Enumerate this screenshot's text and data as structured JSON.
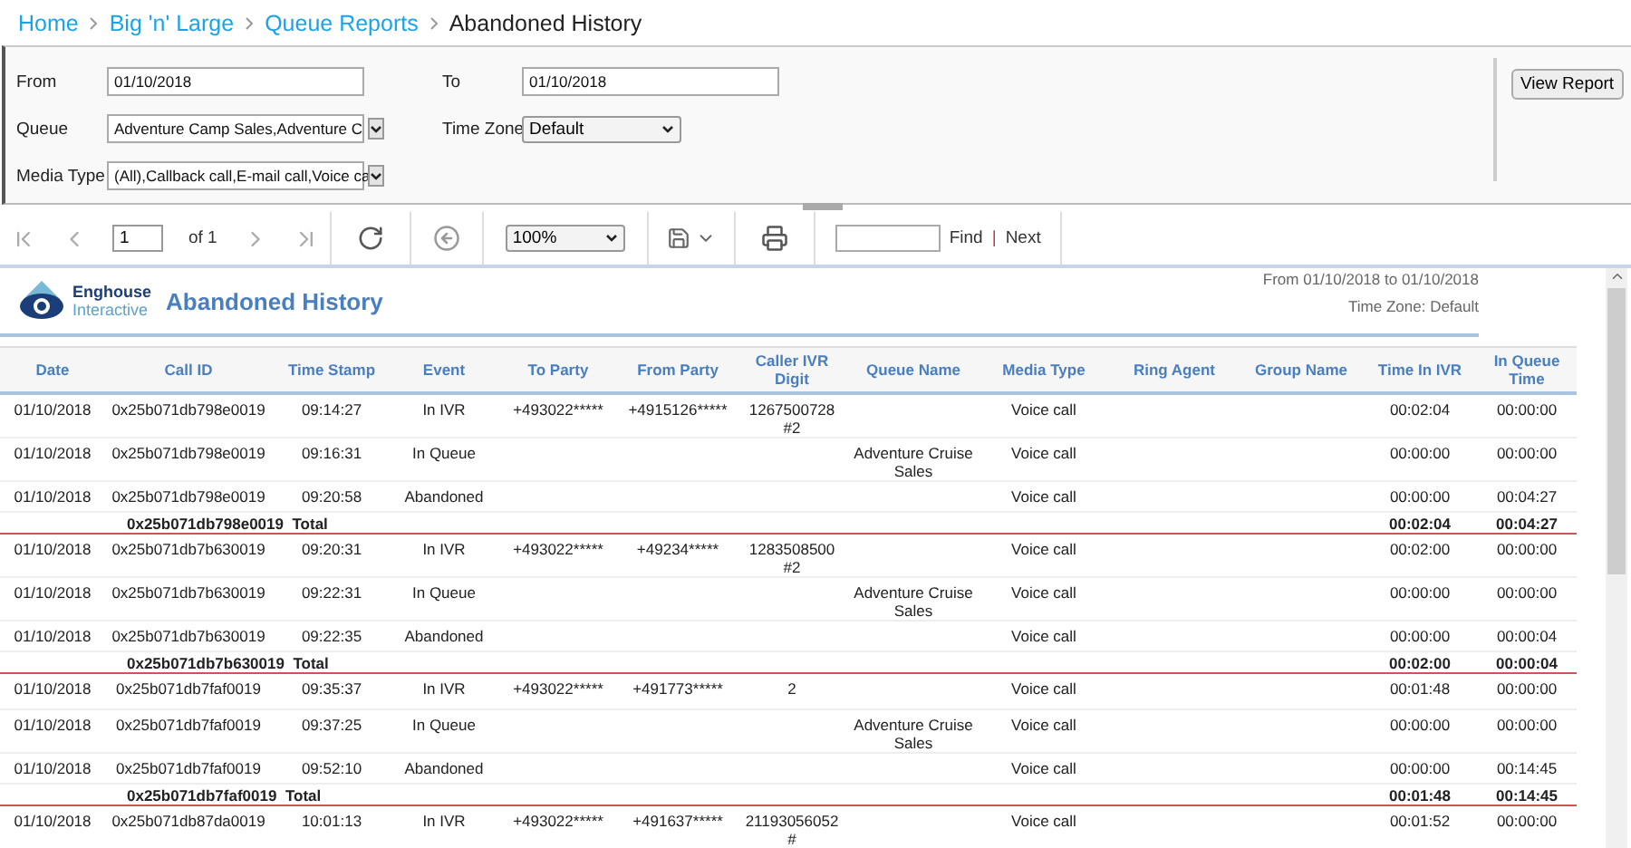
{
  "breadcrumb": [
    {
      "label": "Home",
      "kind": "link"
    },
    {
      "label": "Big 'n' Large",
      "kind": "link"
    },
    {
      "label": "Queue Reports",
      "kind": "link"
    },
    {
      "label": "Abandoned History",
      "kind": "current"
    }
  ],
  "parameters": {
    "from": {
      "label": "From",
      "value": "01/10/2018"
    },
    "to": {
      "label": "To",
      "value": "01/10/2018"
    },
    "queue": {
      "label": "Queue",
      "value": "Adventure Camp Sales,Adventure C"
    },
    "time_zone": {
      "label": "Time Zone",
      "value": "Default"
    },
    "media_type": {
      "label": "Media Type",
      "value": "(All),Callback call,E-mail call,Voice ca"
    },
    "view_button": "View Report"
  },
  "toolbar": {
    "page": "1",
    "page_count": "of 1",
    "zoom": "100%",
    "find": "Find",
    "separator": "|",
    "next": "Next"
  },
  "report": {
    "brand_line_1": "Enghouse",
    "brand_line_2": "Interactive",
    "title": "Abandoned History",
    "range": "From 01/10/2018 to 01/10/2018",
    "time_zone": "Time Zone: Default",
    "table": {
      "columns": [
        "Date",
        "Call ID",
        "Time Stamp",
        "Event",
        "To Party",
        "From Party",
        "Caller IVR Digit",
        "Queue Name",
        "Media Type",
        "Ring Agent",
        "Group Name",
        "Time In IVR",
        "In Queue Time"
      ],
      "groups": [
        {
          "rows": [
            {
              "date": "01/10/2018",
              "call_id": "0x25b071db798e0019",
              "time_stamp": "09:14:27",
              "event": "In IVR",
              "to_party": "+493022*****",
              "from_party": "+4915126*****",
              "caller_ivr_digit": "1267500728 #2",
              "media_type": "Voice call",
              "time_in_ivr": "00:02:04",
              "in_queue_time": "00:00:00"
            },
            {
              "date": "01/10/2018",
              "call_id": "0x25b071db798e0019",
              "time_stamp": "09:16:31",
              "event": "In Queue",
              "queue_name": "Adventure Cruise Sales",
              "media_type": "Voice call",
              "time_in_ivr": "00:00:00",
              "in_queue_time": "00:00:00"
            },
            {
              "date": "01/10/2018",
              "call_id": "0x25b071db798e0019",
              "time_stamp": "09:20:58",
              "event": "Abandoned",
              "media_type": "Voice call",
              "time_in_ivr": "00:00:00",
              "in_queue_time": "00:04:27"
            }
          ],
          "total": {
            "call_id": "0x25b071db798e0019",
            "label": "Total",
            "time_in_ivr": "00:02:04",
            "in_queue_time": "00:04:27"
          }
        },
        {
          "rows": [
            {
              "date": "01/10/2018",
              "call_id": "0x25b071db7b630019",
              "time_stamp": "09:20:31",
              "event": "In IVR",
              "to_party": "+493022*****",
              "from_party": "+49234*****",
              "caller_ivr_digit": "1283508500 #2",
              "media_type": "Voice call",
              "time_in_ivr": "00:02:00",
              "in_queue_time": "00:00:00"
            },
            {
              "date": "01/10/2018",
              "call_id": "0x25b071db7b630019",
              "time_stamp": "09:22:31",
              "event": "In Queue",
              "queue_name": "Adventure Cruise Sales",
              "media_type": "Voice call",
              "time_in_ivr": "00:00:00",
              "in_queue_time": "00:00:00"
            },
            {
              "date": "01/10/2018",
              "call_id": "0x25b071db7b630019",
              "time_stamp": "09:22:35",
              "event": "Abandoned",
              "media_type": "Voice call",
              "time_in_ivr": "00:00:00",
              "in_queue_time": "00:00:04"
            }
          ],
          "total": {
            "call_id": "0x25b071db7b630019",
            "label": "Total",
            "time_in_ivr": "00:02:00",
            "in_queue_time": "00:00:04"
          }
        },
        {
          "rows": [
            {
              "date": "01/10/2018",
              "call_id": "0x25b071db7faf0019",
              "time_stamp": "09:35:37",
              "event": "In IVR",
              "to_party": "+493022*****",
              "from_party": "+491773*****",
              "caller_ivr_digit": "2",
              "media_type": "Voice call",
              "time_in_ivr": "00:01:48",
              "in_queue_time": "00:00:00"
            },
            {
              "date": "01/10/2018",
              "call_id": "0x25b071db7faf0019",
              "time_stamp": "09:37:25",
              "event": "In Queue",
              "queue_name": "Adventure Cruise Sales",
              "media_type": "Voice call",
              "time_in_ivr": "00:00:00",
              "in_queue_time": "00:00:00"
            },
            {
              "date": "01/10/2018",
              "call_id": "0x25b071db7faf0019",
              "time_stamp": "09:52:10",
              "event": "Abandoned",
              "media_type": "Voice call",
              "time_in_ivr": "00:00:00",
              "in_queue_time": "00:14:45"
            }
          ],
          "total": {
            "call_id": "0x25b071db7faf0019",
            "label": "Total",
            "time_in_ivr": "00:01:48",
            "in_queue_time": "00:14:45"
          }
        },
        {
          "rows": [
            {
              "date": "01/10/2018",
              "call_id": "0x25b071db87da0019",
              "time_stamp": "10:01:13",
              "event": "In IVR",
              "to_party": "+493022*****",
              "from_party": "+491637*****",
              "caller_ivr_digit": "21193056052 #",
              "media_type": "Voice call",
              "time_in_ivr": "00:01:52",
              "in_queue_time": "00:00:00"
            }
          ]
        }
      ]
    }
  }
}
